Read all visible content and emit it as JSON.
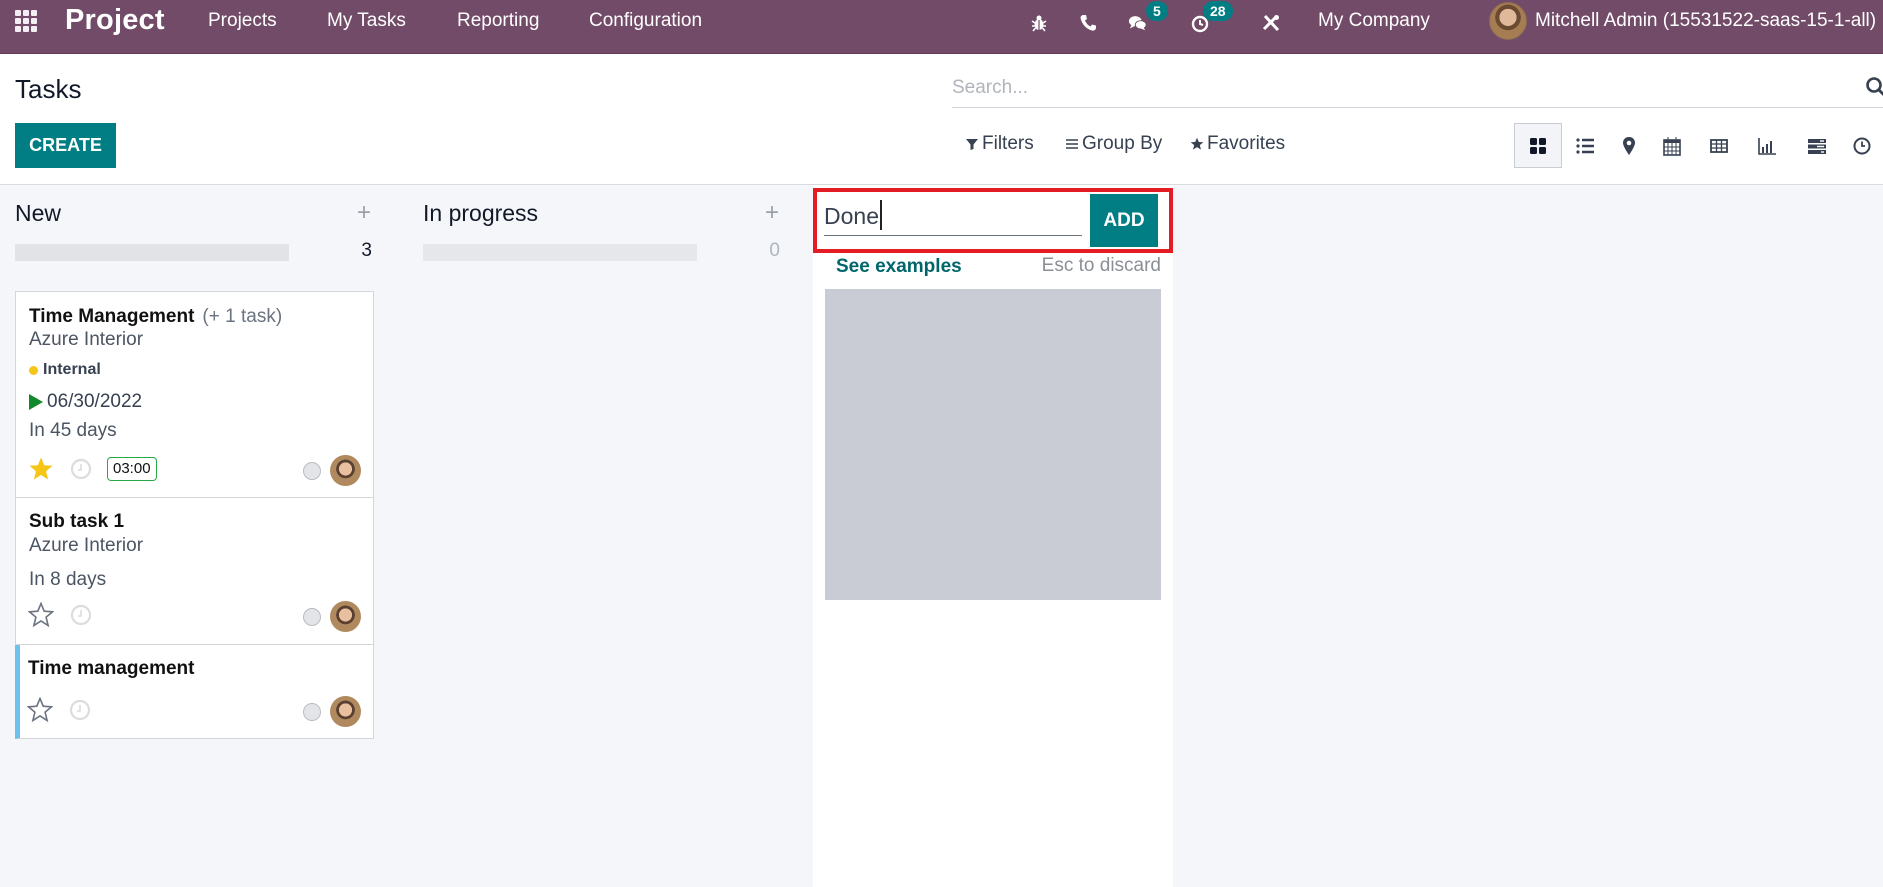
{
  "navbar": {
    "app_name": "Project",
    "menu": [
      "Projects",
      "My Tasks",
      "Reporting",
      "Configuration"
    ],
    "icons": [
      "bug-icon",
      "phone-icon",
      "chat-icon",
      "activity-clock-icon",
      "tools-icon"
    ],
    "messages_count": "5",
    "activities_count": "28",
    "company": "My Company",
    "user": "Mitchell Admin (15531522-saas-15-1-all)",
    "color": "#714B67"
  },
  "control": {
    "title": "Tasks",
    "create_label": "CREATE",
    "search_placeholder": "Search...",
    "filters_label": "Filters",
    "groupby_label": "Group By",
    "favorites_label": "Favorites",
    "views": [
      "kanban",
      "list",
      "map",
      "calendar",
      "pivot",
      "graph",
      "gantt",
      "activity"
    ],
    "active_view": "kanban"
  },
  "columns": [
    {
      "title": "New",
      "count": "3",
      "cards": [
        {
          "title": "Time Management",
          "subtasks": "(+ 1 task)",
          "customer": "Azure Interior",
          "tag": "Internal",
          "deadline": "06/30/2022",
          "relative": "In 45 days",
          "starred": true,
          "time": "03:00"
        },
        {
          "title": "Sub task 1",
          "customer": "Azure Interior",
          "relative": "In 8 days",
          "starred": false
        },
        {
          "title": "Time management",
          "starred": false
        }
      ]
    },
    {
      "title": "In progress",
      "count": "0",
      "cards": []
    }
  ],
  "quick_create": {
    "value": "Done",
    "add_label": "ADD",
    "examples_label": "See examples",
    "discard_hint": "Esc to discard"
  },
  "colors": {
    "primary": "#017e84",
    "highlight_box": "#e41c24",
    "tag_dot": "#f5c518",
    "deadline_arrow": "#12892c",
    "kanban_color_bar": "#6cc1ed"
  }
}
